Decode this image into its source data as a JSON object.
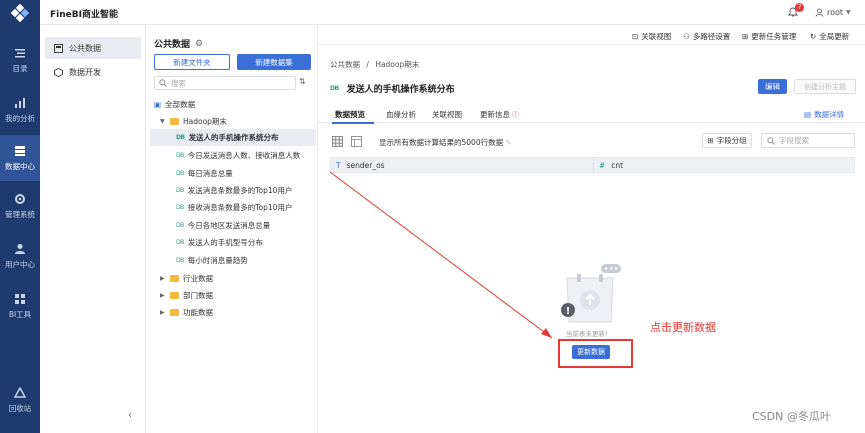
{
  "app": {
    "title": "FineBI商业智能",
    "notification_count": "7",
    "user": "root"
  },
  "leftnav": [
    {
      "label": "目录",
      "icon": "catalog-icon"
    },
    {
      "label": "我的分析",
      "icon": "analysis-icon"
    },
    {
      "label": "数据中心",
      "icon": "database-icon",
      "active": true
    },
    {
      "label": "管理系统",
      "icon": "settings-icon"
    },
    {
      "label": "用户中心",
      "icon": "user-icon"
    },
    {
      "label": "BI工具",
      "icon": "tools-icon"
    },
    {
      "label": "回收站",
      "icon": "recycle-icon"
    }
  ],
  "subnav": [
    {
      "label": "公共数据",
      "active": true
    },
    {
      "label": "数据开发"
    }
  ],
  "tree_panel": {
    "title": "公共数据",
    "new_folder": "新建文件夹",
    "new_dataset": "新建数据集",
    "search_placeholder": "搜索",
    "items": [
      {
        "label": "全部数据",
        "type": "root"
      },
      {
        "label": "Hadoop期末",
        "type": "folder",
        "expanded": true
      },
      {
        "label": "发送人的手机操作系统分布",
        "type": "dataset",
        "active": true
      },
      {
        "label": "今日发送消息人数、接收消息人数",
        "type": "dataset"
      },
      {
        "label": "每日消息总量",
        "type": "dataset"
      },
      {
        "label": "发送消息条数最多的Top10用户",
        "type": "dataset"
      },
      {
        "label": "接收消息条数最多的Top10用户",
        "type": "dataset"
      },
      {
        "label": "今日各地区发送消息总量",
        "type": "dataset"
      },
      {
        "label": "发送人的手机型号分布",
        "type": "dataset"
      },
      {
        "label": "每小时消息量趋势",
        "type": "dataset"
      },
      {
        "label": "行业数据",
        "type": "folder"
      },
      {
        "label": "部门数据",
        "type": "folder"
      },
      {
        "label": "功能数据",
        "type": "folder"
      }
    ],
    "dataset_tag": "DB"
  },
  "toolbar": {
    "items": [
      "关联视图",
      "多路径设置",
      "更新任务管理",
      "全局更新"
    ]
  },
  "main": {
    "breadcrumb_root": "公共数据",
    "breadcrumb_sep": "/",
    "breadcrumb_folder": "Hadoop期末",
    "title": "发送人的手机操作系统分布",
    "edit": "编辑",
    "create_topic": "创建分析主题",
    "tabs": [
      "数据预览",
      "血缘分析",
      "关联视图",
      "更新信息"
    ],
    "data_detail": "数据详情",
    "preview_note": "显示所有数据计算结果的5000行数据",
    "field_group": "字段分组",
    "field_search_placeholder": "字段搜索",
    "columns": [
      {
        "name": "sender_os",
        "type_icon": "T"
      },
      {
        "name": "cnt",
        "type_icon": "#"
      }
    ],
    "empty_text": "当前表未更新！",
    "update_button": "更新数据"
  },
  "annotation": {
    "text": "点击更新数据",
    "color": "#e53935"
  },
  "watermark": "CSDN @冬瓜叶",
  "colors": {
    "nav_bg": "#1f3b6e",
    "primary": "#3a6fd8",
    "highlight": "#e53935"
  }
}
